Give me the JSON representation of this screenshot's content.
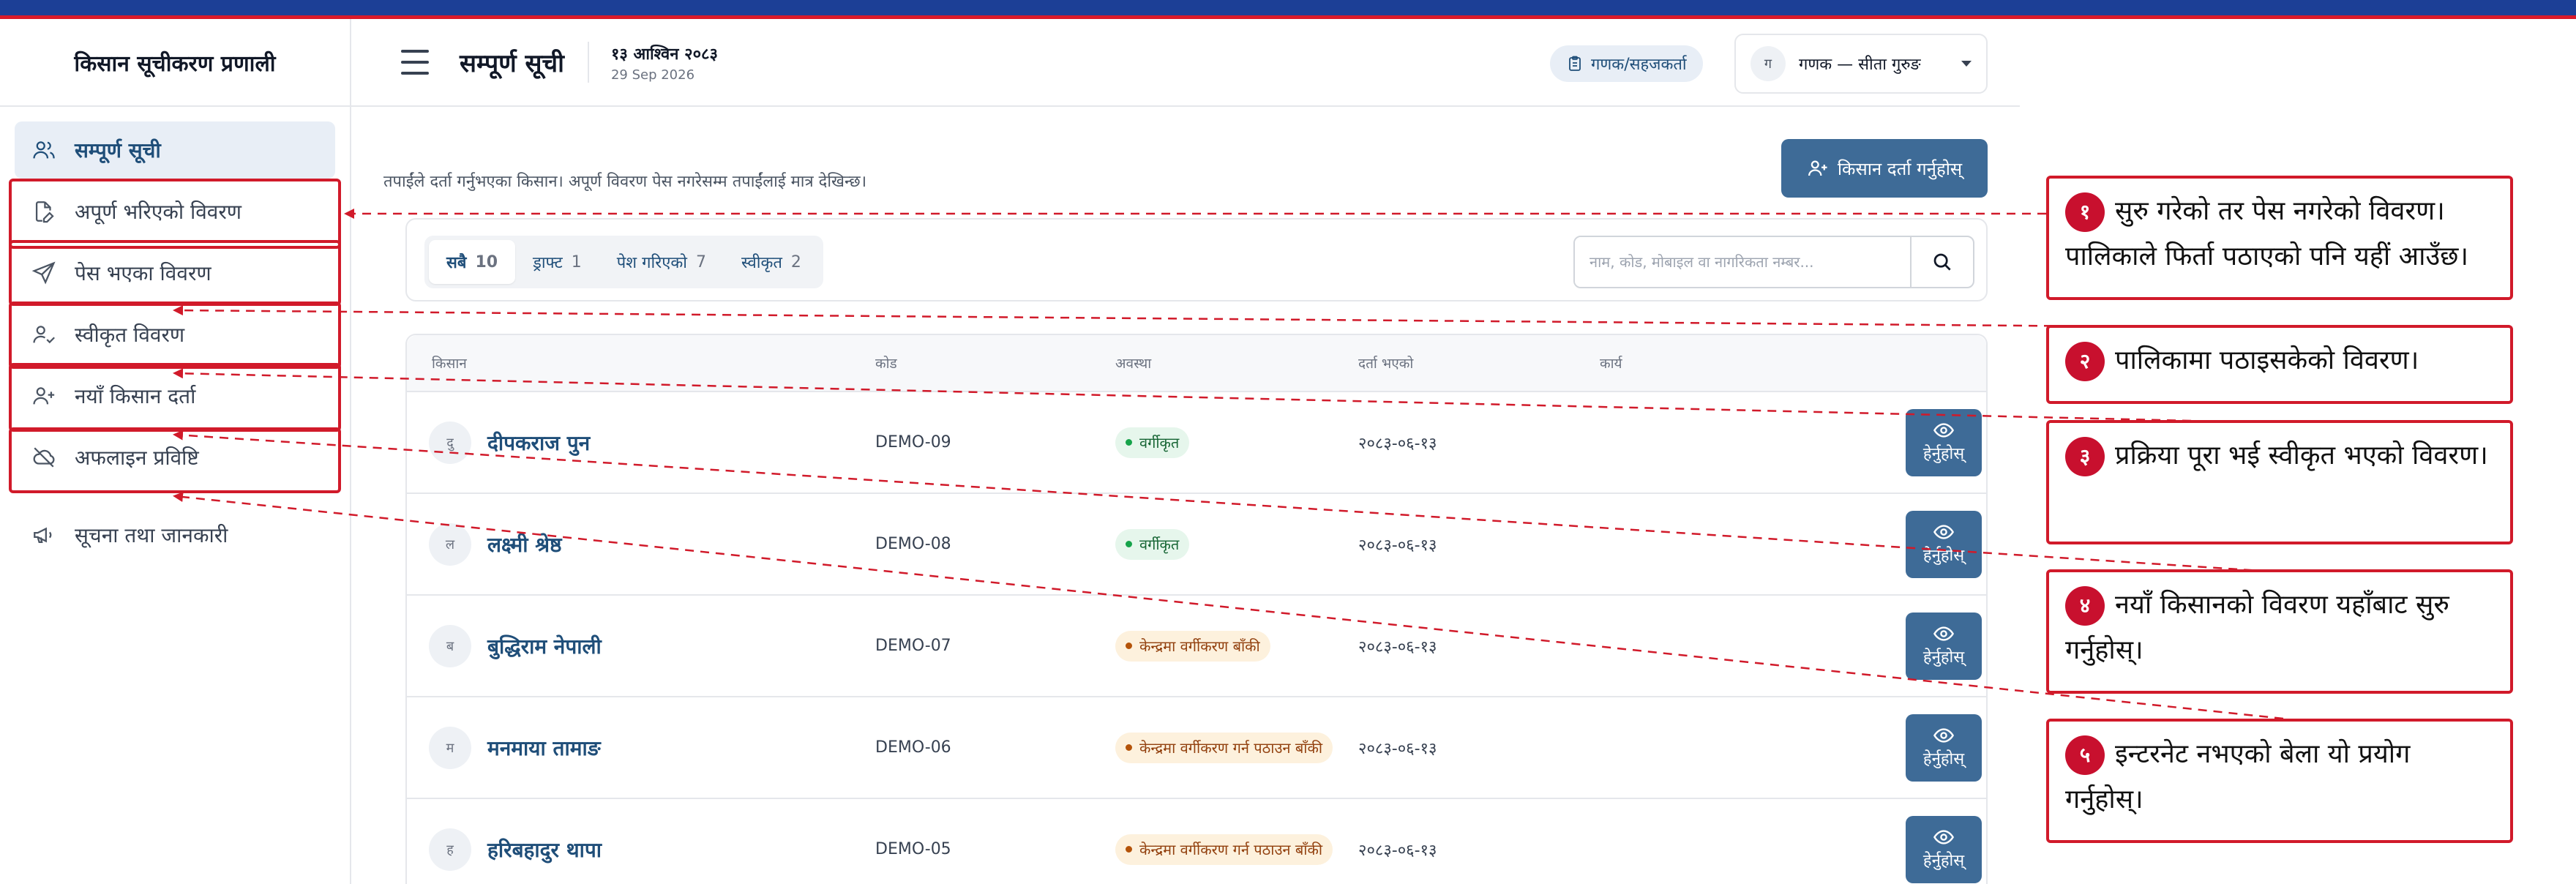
{
  "app": {
    "brand": "किसान सूचीकरण प्रणाली"
  },
  "sidebar": {
    "items": [
      {
        "label": "सम्पूर्ण सूची",
        "icon": "users-icon",
        "active": true
      },
      {
        "label": "अपूर्ण भरिएको विवरण",
        "icon": "edit-file-icon"
      },
      {
        "label": "पेस भएका विवरण",
        "icon": "send-icon"
      },
      {
        "label": "स्वीकृत विवरण",
        "icon": "user-check-icon"
      },
      {
        "label": "नयाँ किसान दर्ता",
        "icon": "user-plus-icon"
      },
      {
        "label": "अफलाइन प्रविष्टि",
        "icon": "cloud-off-icon"
      },
      {
        "label": "सूचना तथा जानकारी",
        "icon": "megaphone-icon"
      }
    ]
  },
  "header": {
    "title": "सम्पूर्ण सूची",
    "date_np": "१३ आश्विन २०८३",
    "date_en": "29 Sep 2026",
    "role": "गणक/सहजकर्ता",
    "user_initial": "ग",
    "user": "गणक — सीता गुरुङ"
  },
  "main": {
    "register_button": "किसान दर्ता गर्नुहोस्",
    "intro": "तपाईंले दर्ता गर्नुभएका किसान। अपूर्ण विवरण पेस नगरेसम्म तपाईंलाई मात्र देखिन्छ।",
    "tabs": [
      {
        "label": "सबै",
        "count": "10",
        "active": true
      },
      {
        "label": "ड्राफ्ट",
        "count": "1"
      },
      {
        "label": "पेश गरिएको",
        "count": "7"
      },
      {
        "label": "स्वीकृत",
        "count": "2"
      }
    ],
    "search_placeholder": "नाम, कोड, मोबाइल वा नागरिकता नम्बर...",
    "columns": [
      "किसान",
      "कोड",
      "अवस्था",
      "दर्ता भएको",
      "कार्य"
    ],
    "rows": [
      {
        "initial": "दु",
        "name": "दीपकराज पुन",
        "code": "DEMO-09",
        "status": "वर्गीकृत",
        "status_kind": "green",
        "date": "२०८३-०६-१३",
        "action": "हेर्नुहोस्"
      },
      {
        "initial": "ल",
        "name": "लक्ष्मी श्रेष्ठ",
        "code": "DEMO-08",
        "status": "वर्गीकृत",
        "status_kind": "green",
        "date": "२०८३-०६-१३",
        "action": "हेर्नुहोस्"
      },
      {
        "initial": "ब",
        "name": "बुद्धिराम नेपाली",
        "code": "DEMO-07",
        "status": "केन्द्रमा वर्गीकरण बाँकी",
        "status_kind": "amber",
        "date": "२०८३-०६-१३",
        "action": "हेर्नुहोस्"
      },
      {
        "initial": "म",
        "name": "मनमाया तामाङ",
        "code": "DEMO-06",
        "status": "केन्द्रमा वर्गीकरण गर्न पठाउन बाँकी",
        "status_kind": "amber",
        "date": "२०८३-०६-१३",
        "action": "हेर्नुहोस्"
      },
      {
        "initial": "ह",
        "name": "हरिबहादुर थापा",
        "code": "DEMO-05",
        "status": "केन्द्रमा वर्गीकरण गर्न पठाउन बाँकी",
        "status_kind": "amber",
        "date": "२०८३-०६-१३",
        "action": "हेर्नुहोस्"
      }
    ]
  },
  "annotations": [
    {
      "num": "१",
      "text": "सुरु गरेको तर पेस नगरेको विवरण। पालिकाले फिर्ता पठाएको पनि यहीं आउँछ।"
    },
    {
      "num": "२",
      "text": "पालिकामा पठाइसकेको विवरण।"
    },
    {
      "num": "३",
      "text": "प्रक्रिया पूरा भई स्वीकृत भएको विवरण।"
    },
    {
      "num": "४",
      "text": "नयाँ किसानको विवरण यहाँबाट सुरु गर्नुहोस्।"
    },
    {
      "num": "५",
      "text": "इन्टरनेट नभएको बेला यो प्रयोग गर्नुहोस्।"
    }
  ],
  "colors": {
    "accent": "#1f4e79",
    "button": "#3e6b97",
    "annotation": "#d11a2a"
  }
}
